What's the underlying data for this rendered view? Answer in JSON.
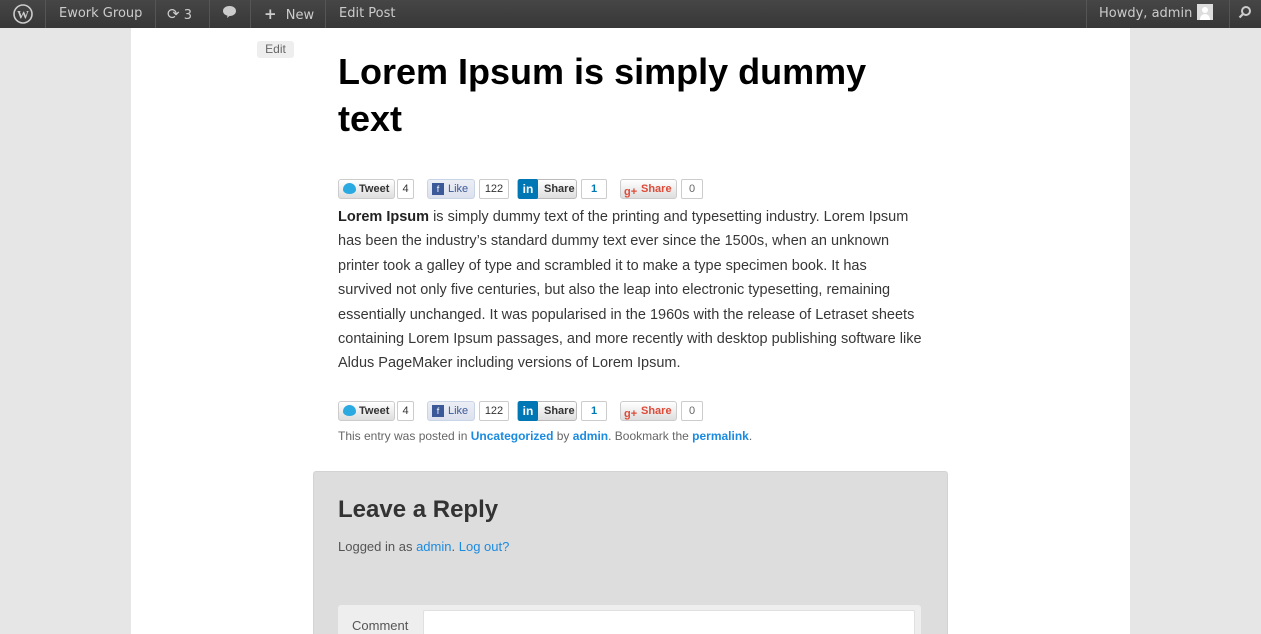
{
  "admin_bar": {
    "site_name": "Ework Group",
    "updates_count": "3",
    "new_label": "New",
    "edit_post_label": "Edit Post",
    "howdy": "Howdy, admin"
  },
  "post": {
    "edit_label": "Edit",
    "title": "Lorem Ipsum is simply dummy text",
    "body_bold": "Lorem Ipsum",
    "body_rest": " is simply dummy text of the printing and typesetting industry. Lorem Ipsum has been the industry’s standard dummy text ever since the 1500s, when an unknown printer took a galley of type and scrambled it to make a type specimen book. It has survived not only five centuries, but also the leap into electronic typesetting, remaining essentially unchanged. It was popularised in the 1960s with the release of Letraset sheets containing Lorem Ipsum passages, and more recently with desktop publishing software like Aldus PageMaker including versions of Lorem Ipsum."
  },
  "share": {
    "tweet_label": "Tweet",
    "tweet_count": "4",
    "like_label": "Like",
    "like_count": "122",
    "linkedin_label": "Share",
    "linkedin_count": "1",
    "gplus_label": "Share",
    "gplus_count": "0"
  },
  "meta": {
    "prefix": "This entry was posted in ",
    "category": "Uncategorized",
    "by": " by ",
    "author": "admin",
    "bookmark": ". Bookmark the ",
    "permalink": "permalink",
    "end": "."
  },
  "reply": {
    "title": "Leave a Reply",
    "logged_prefix": "Logged in as ",
    "user": "admin",
    "dot": ". ",
    "logout": "Log out?",
    "comment_label": "Comment"
  }
}
